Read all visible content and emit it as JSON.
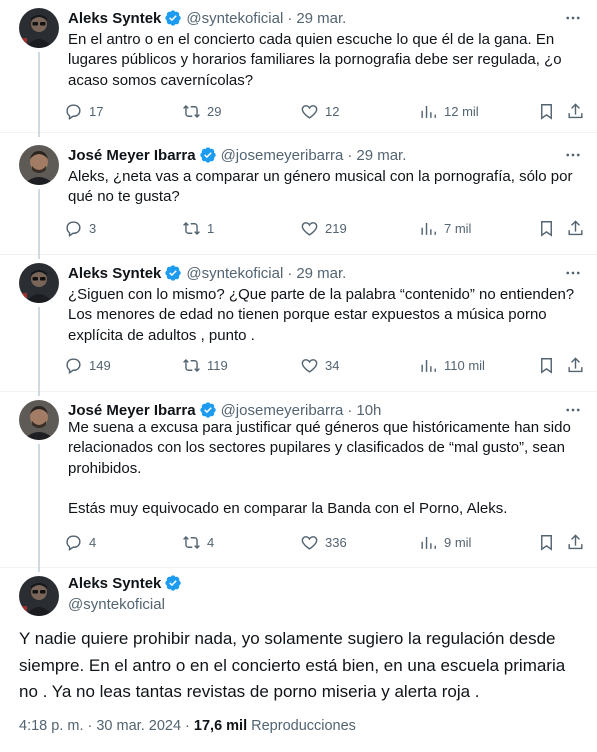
{
  "colors": {
    "accent": "#1d9bf0",
    "muted": "#536471",
    "text": "#0f1419",
    "border": "#eff3f4"
  },
  "icons": {
    "verified": "verified-badge-icon",
    "more": "more-dots-icon",
    "reply": "reply-icon",
    "retweet": "retweet-icon",
    "like": "heart-icon",
    "views": "views-chart-icon",
    "bookmark": "bookmark-icon",
    "share": "share-icon"
  },
  "tweets": [
    {
      "name": "Aleks Syntek",
      "handle": "@syntekoficial",
      "time": "29 mar.",
      "text": "En el antro o en el concierto cada quien escuche lo que él de la gana. En lugares públicos y horarios familiares la pornografia debe ser regulada, ¿o acaso somos cavernícolas?",
      "replies": "17",
      "retweets": "29",
      "likes": "12",
      "views": "12 mil"
    },
    {
      "name": "José Meyer Ibarra",
      "handle": "@josemeyeribarra",
      "time": "29 mar.",
      "text": "Aleks, ¿neta vas a comparar un género musical con la pornografía, sólo por qué no te gusta?",
      "replies": "3",
      "retweets": "1",
      "likes": "219",
      "views": "7 mil"
    },
    {
      "name": "Aleks Syntek",
      "handle": "@syntekoficial",
      "time": "29 mar.",
      "text": "¿Siguen con lo mismo? ¿Que parte de la palabra “contenido” no entienden? Los menores de edad no tienen porque estar expuestos a música porno explícita de adultos , punto .",
      "replies": "149",
      "retweets": "119",
      "likes": "34",
      "views": "110 mil"
    },
    {
      "name": "José Meyer Ibarra",
      "handle": "@josemeyeribarra",
      "time": "10h",
      "text": "Me suena a excusa para justificar qué géneros que históricamente han sido relacionados con los sectores pupilares y clasificados de “mal gusto”, sean prohibidos.\n\nEstás muy equivocado en comparar la Banda con el Porno, Aleks.",
      "replies": "4",
      "retweets": "4",
      "likes": "336",
      "views": "9 mil"
    }
  ],
  "main": {
    "name": "Aleks Syntek",
    "handle": "@syntekoficial",
    "text": "Y nadie quiere prohibir nada, yo solamente sugiero la regulación desde siempre. En el antro o en el concierto está bien, en una escuela primaria no . Ya no leas tantas revistas de porno miseria y alerta roja .",
    "time": "4:18 p. m. · 30 mar. 2024 · ",
    "views": "17,6 mil",
    "views_label": " Reproducciones"
  }
}
